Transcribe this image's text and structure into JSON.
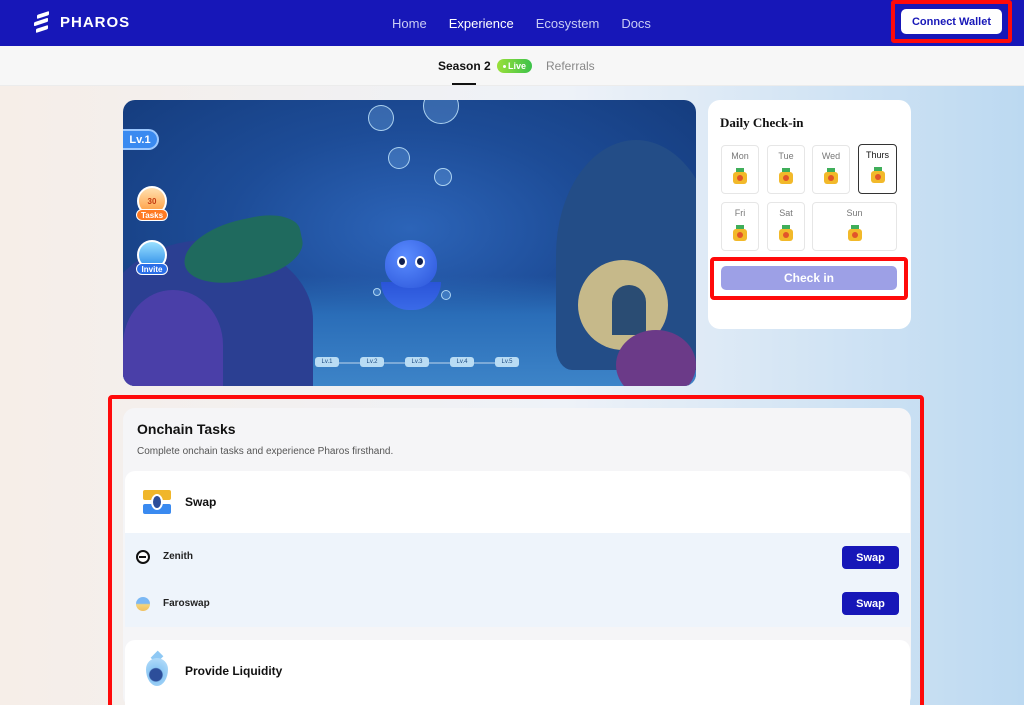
{
  "header": {
    "brand": "PHAROS",
    "nav": [
      {
        "label": "Home",
        "active": false
      },
      {
        "label": "Experience",
        "active": true
      },
      {
        "label": "Ecosystem",
        "active": false
      },
      {
        "label": "Docs",
        "active": false
      }
    ],
    "connect_wallet": "Connect Wallet"
  },
  "subnav": {
    "season": "Season 2",
    "live": "Live",
    "referrals": "Referrals"
  },
  "game": {
    "level": "Lv.1",
    "tasks_label": "Tasks",
    "tasks_count": "30",
    "invite_label": "Invite",
    "levels": [
      "Lv.1",
      "Lv.2",
      "Lv.3",
      "Lv.4",
      "Lv.5"
    ]
  },
  "checkin": {
    "title": "Daily Check-in",
    "days": [
      "Mon",
      "Tue",
      "Wed",
      "Thurs",
      "Fri",
      "Sat",
      "Sun"
    ],
    "current_day": "Thurs",
    "button": "Check in"
  },
  "onchain": {
    "title": "Onchain Tasks",
    "subtitle": "Complete onchain tasks and experience Pharos firsthand.",
    "swap": {
      "title": "Swap",
      "rows": [
        {
          "name": "Zenith",
          "button": "Swap"
        },
        {
          "name": "Faroswap",
          "button": "Swap"
        }
      ]
    },
    "liquidity": {
      "title": "Provide Liquidity"
    }
  },
  "colors": {
    "nav_bg": "#1717b8",
    "accent": "#1717b8",
    "checkin_button": "#9da0e6",
    "live_badge": "#3cc24a",
    "highlight": "#ff0a0a"
  },
  "icons": {
    "logo": "pharos-logo-icon",
    "tasks": "tasks-icon",
    "invite": "invite-icon",
    "medal": "medal-icon",
    "swap": "swap-icon",
    "zenith": "zenith-icon",
    "faroswap": "faroswap-icon",
    "liquidity": "liquidity-drop-icon"
  }
}
